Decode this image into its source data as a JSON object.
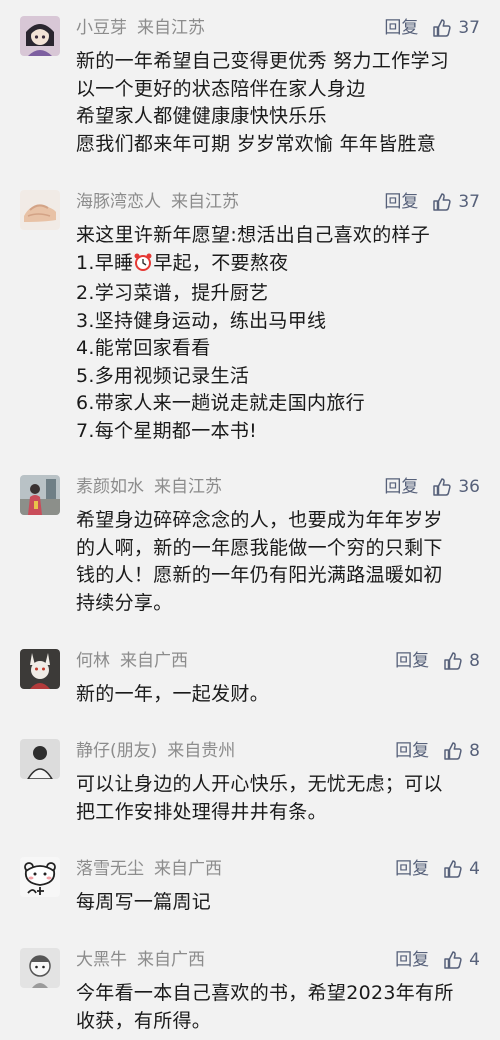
{
  "comments": [
    {
      "user": "小豆芽",
      "location": "来自江苏",
      "reply_label": "回复",
      "likes": "37",
      "text": "新的一年希望自己变得更优秀 努力工作学习\n以一个更好的状态陪伴在家人身边\n希望家人都健健康康快快乐乐\n愿我们都来年可期 岁岁常欢愉 年年皆胜意"
    },
    {
      "user": "海豚湾恋人",
      "location": "来自江苏",
      "reply_label": "回复",
      "likes": "37",
      "text_intro": "来这里许新年愿望:想活出自己喜欢的样子",
      "text_line1_a": "1.早睡",
      "text_line1_emoji": "alarm-clock-icon",
      "text_line1_b": "早起，不要熬夜",
      "text_rest": "2.学习菜谱，提升厨艺\n3.坚持健身运动，练出马甲线\n4.能常回家看看\n5.多用视频记录生活\n6.带家人来一趟说走就走国内旅行\n7.每个星期都一本书!"
    },
    {
      "user": "素颜如水",
      "location": "来自江苏",
      "reply_label": "回复",
      "likes": "36",
      "text": "希望身边碎碎念念的人，也要成为年年岁岁\n的人啊，新的一年愿我能做一个穷的只剩下\n钱的人！愿新的一年仍有阳光满路温暖如初\n持续分享。"
    },
    {
      "user": "何林",
      "location": "来自广西",
      "reply_label": "回复",
      "likes": "8",
      "text": "新的一年，一起发财。"
    },
    {
      "user": "静仔(朋友)",
      "location": "来自贵州",
      "reply_label": "回复",
      "likes": "8",
      "text": "可以让身边的人开心快乐，无忧无虑；可以\n把工作安排处理得井井有条。"
    },
    {
      "user": "落雪无尘",
      "location": "来自广西",
      "reply_label": "回复",
      "likes": "4",
      "text": "每周写一篇周记"
    },
    {
      "user": "大黑牛",
      "location": "来自广西",
      "reply_label": "回复",
      "likes": "4",
      "text": "今年看一本自己喜欢的书，希望2023年有所\n收获，有所得。"
    }
  ],
  "colors": {
    "background": "#f2f2f2",
    "name_text": "#8c8c8c",
    "action_text": "#57617a",
    "body_text": "#1a1a1a"
  }
}
